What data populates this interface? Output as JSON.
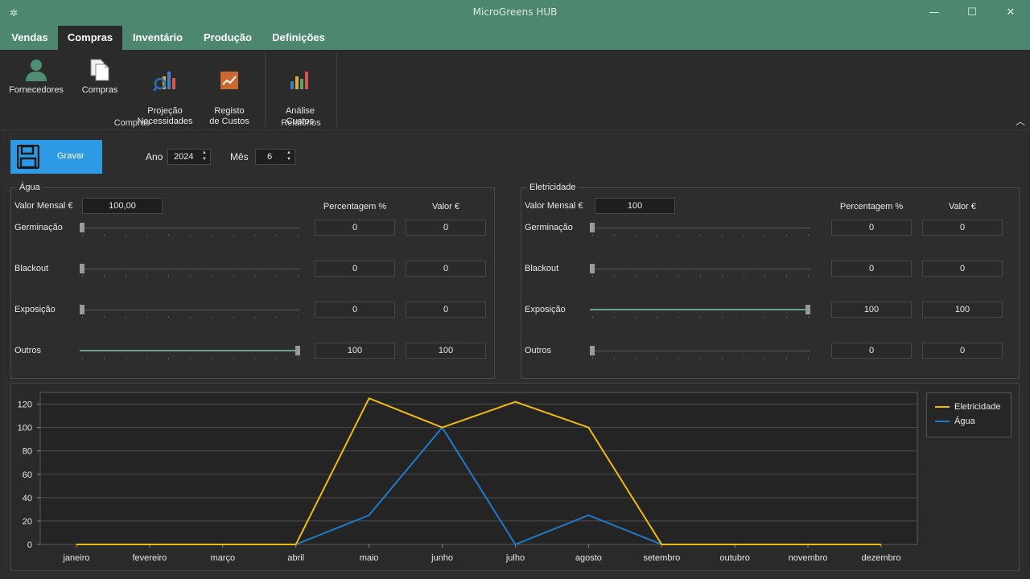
{
  "window": {
    "title": "MicroGreens HUB",
    "minimize_glyph": "—",
    "maximize_glyph": "☐",
    "close_glyph": "✕"
  },
  "menu": {
    "tabs": [
      {
        "label": "Vendas",
        "active": false
      },
      {
        "label": "Compras",
        "active": true
      },
      {
        "label": "Inventário",
        "active": false
      },
      {
        "label": "Produção",
        "active": false
      },
      {
        "label": "Definições",
        "active": false
      }
    ]
  },
  "ribbon": {
    "groups": [
      {
        "label": "Compras"
      },
      {
        "label": "Relatórios"
      }
    ],
    "buttons": [
      {
        "label": "Fornecedores",
        "icon": "supplier-person-icon"
      },
      {
        "label": "Compras",
        "icon": "documents-icon"
      },
      {
        "label": "Projeção\nNecessidades",
        "icon": "projection-chart-search-icon"
      },
      {
        "label": "Registo\nde Custos",
        "icon": "cost-trend-icon"
      },
      {
        "label": "Análise\nCustos",
        "icon": "bar-chart-icon"
      }
    ]
  },
  "toolbar": {
    "save_label": "Gravar",
    "year_label": "Ano",
    "year_value": "2024",
    "month_label": "Mês",
    "month_value": "6"
  },
  "water": {
    "title": "Água",
    "monthly_label": "Valor Mensal €",
    "monthly_value": "100,00",
    "pct_header": "Percentagem %",
    "value_header": "Valor €",
    "rows": [
      {
        "label": "Germinação",
        "pct": "0",
        "value": "0",
        "level": 0
      },
      {
        "label": "Blackout",
        "pct": "0",
        "value": "0",
        "level": 0
      },
      {
        "label": "Exposição",
        "pct": "0",
        "value": "0",
        "level": 0
      },
      {
        "label": "Outros",
        "pct": "100",
        "value": "100",
        "level": 100
      }
    ]
  },
  "electricity": {
    "title": "Eletricidade",
    "monthly_label": "Valor Mensal €",
    "monthly_value": "100",
    "pct_header": "Percentagem %",
    "value_header": "Valor €",
    "rows": [
      {
        "label": "Germinação",
        "pct": "0",
        "value": "0",
        "level": 0
      },
      {
        "label": "Blackout",
        "pct": "0",
        "value": "0",
        "level": 0
      },
      {
        "label": "Exposição",
        "pct": "100",
        "value": "100",
        "level": 100
      },
      {
        "label": "Outros",
        "pct": "0",
        "value": "0",
        "level": 0
      }
    ]
  },
  "colors": {
    "accent": "#4e8770",
    "save": "#2e9ae6",
    "electricity_series": "#f2b90f",
    "water_series": "#1f7bc7"
  },
  "chart_data": {
    "type": "line",
    "categories": [
      "janeiro",
      "fevereiro",
      "março",
      "abril",
      "maio",
      "junho",
      "julho",
      "agosto",
      "setembro",
      "outubro",
      "novembro",
      "dezembro"
    ],
    "ylim": [
      0,
      130
    ],
    "yticks": [
      "0",
      "20",
      "40",
      "60",
      "80",
      "100",
      "120"
    ],
    "grid": true,
    "legend_position": "top-right",
    "series": [
      {
        "name": "Eletricidade",
        "values": [
          0,
          0,
          0,
          0,
          125,
          100,
          122,
          100,
          0,
          0,
          0,
          0
        ]
      },
      {
        "name": "Água",
        "values": [
          0,
          0,
          0,
          0,
          25,
          100,
          0,
          25,
          0,
          0,
          0,
          0
        ]
      }
    ]
  }
}
